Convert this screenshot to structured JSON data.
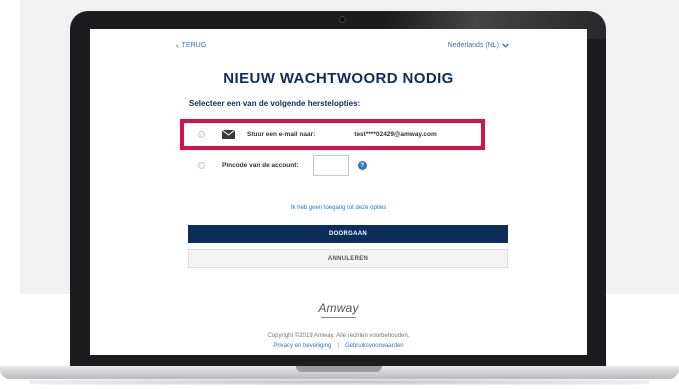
{
  "header": {
    "back_label": "TERUG",
    "language": "Nederlands (NL)"
  },
  "page": {
    "title": "NIEUW WACHTWOORD NODIG",
    "subtitle": "Selecteer een van de volgende herstelopties:"
  },
  "options": {
    "email": {
      "label": "Stuur een e-mail naar:",
      "value": "test****02429@amway.com",
      "icon": "envelope-icon"
    },
    "pin": {
      "label": "Pincode van de account:",
      "value": "",
      "icon": "help-icon"
    }
  },
  "links": {
    "no_access": "Ik heb geen toegang tot deze opties"
  },
  "buttons": {
    "continue_label": "DOORGAAN",
    "cancel_label": "ANNULEREN"
  },
  "footer": {
    "brand": "Amway",
    "copyright": "Copyright ©2019 Amway. Alle rechten voorbehouden.",
    "privacy_link": "Privacy en beveiliging",
    "separator": "|",
    "terms_link": "Gebruiksvoorwaarden"
  },
  "colors": {
    "primary_navy": "#0c2d5c",
    "link_blue": "#2e74c7",
    "highlight_red": "#d41446",
    "device_frame": "#1c1c1e"
  }
}
